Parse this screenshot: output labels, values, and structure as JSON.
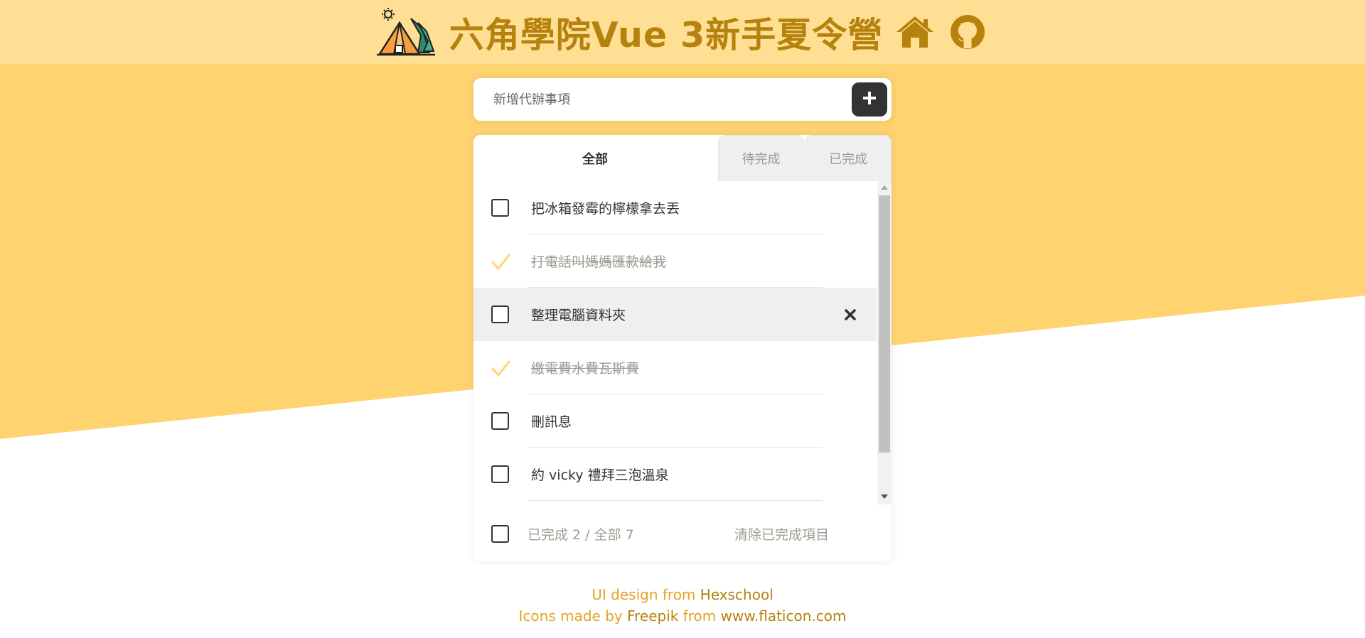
{
  "header": {
    "title": "六角學院Vue 3新手夏令營",
    "logo_icon": "camping-tent-trees-icon",
    "home_icon": "home-icon",
    "github_icon": "github-icon"
  },
  "add_todo": {
    "placeholder": "新增代辦事項",
    "button_icon": "plus-icon"
  },
  "tabs": [
    {
      "label": "全部",
      "active": true
    },
    {
      "label": "待完成",
      "active": false
    },
    {
      "label": "已完成",
      "active": false
    }
  ],
  "todos": [
    {
      "text": "把冰箱發霉的檸檬拿去丟",
      "completed": false
    },
    {
      "text": "打電話叫媽媽匯款給我",
      "completed": true
    },
    {
      "text": "整理電腦資料夾",
      "completed": false,
      "hovered": true
    },
    {
      "text": "繳電費水費瓦斯費",
      "completed": true
    },
    {
      "text": "刪訊息",
      "completed": false
    },
    {
      "text": "約 vicky 禮拜三泡溫泉",
      "completed": false
    }
  ],
  "footer": {
    "count_text": "已完成 2 / 全部 7",
    "clear_label": "清除已完成項目"
  },
  "credits": {
    "line1_prefix": "UI design from",
    "line1_link": "Hexschool",
    "line2_prefix": "Icons made by",
    "line2_author": "Freepik",
    "line2_mid": "from",
    "line2_site": "www.flaticon.com"
  },
  "colors": {
    "header_bg": "#ffdf94",
    "banner_bg": "#ffd370",
    "title": "#b5820e",
    "accent_check": "#ffd370",
    "dark_button": "#333333",
    "muted_text": "#9f9a91"
  }
}
